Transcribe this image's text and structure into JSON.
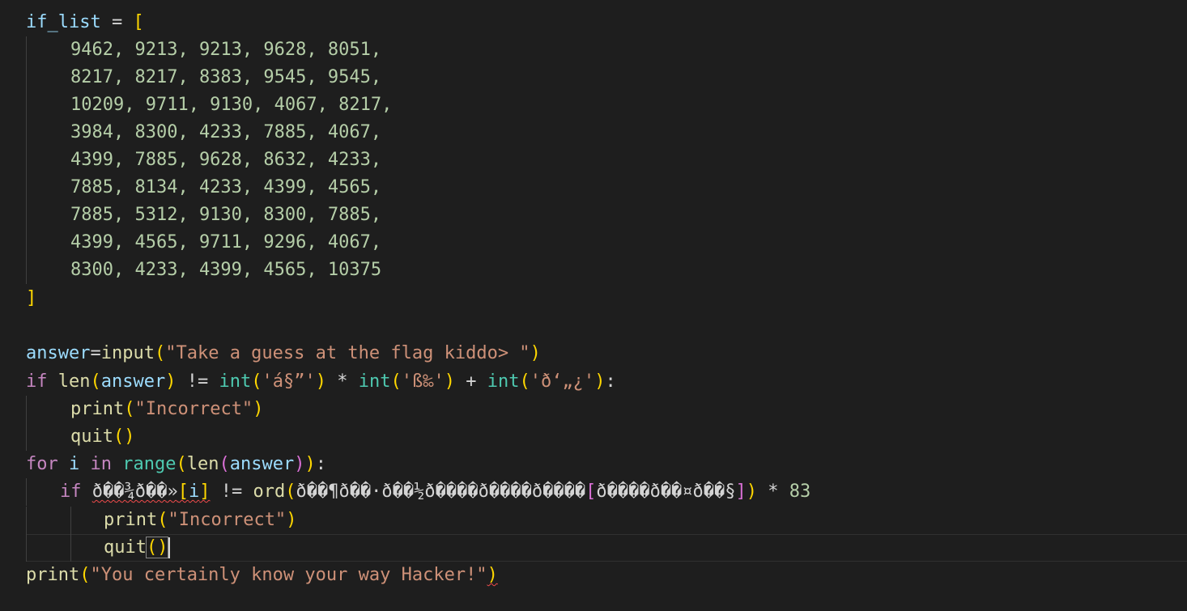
{
  "code": {
    "list_var": "if_list",
    "list_open": "[",
    "list_rows": [
      "9462, 9213, 9213, 9628, 8051,",
      "8217, 8217, 8383, 9545, 9545,",
      "10209, 9711, 9130, 4067, 8217,",
      "3984, 8300, 4233, 7885, 4067,",
      "4399, 7885, 9628, 8632, 4233,",
      "7885, 8134, 4233, 4399, 4565,",
      "7885, 5312, 9130, 8300, 7885,",
      "4399, 4565, 9711, 9296, 4067,",
      "8300, 4233, 4399, 4565, 10375"
    ],
    "list_close": "]",
    "answer_var": "answer",
    "input_fn": "input",
    "input_prompt": "\"Take a guess at the flag kiddo> \"",
    "kw_if": "if",
    "kw_for": "for",
    "kw_in": "in",
    "len_fn": "len",
    "int_fn": "int",
    "range_fn": "range",
    "print_fn": "print",
    "quit_fn": "quit",
    "ord_fn": "ord",
    "op_neq": "!=",
    "op_mul": "*",
    "op_plus": "+",
    "str_a": "'á§”'",
    "str_b": "'ß‰'",
    "str_c": "'ð‘„¿'",
    "incorrect_str": "\"Incorrect\"",
    "loop_var": "i",
    "garbled_1": "ð��¾ð��»",
    "garbled_2": "ð��¶ð��·ð��½ð����ð����ð����",
    "garbled_3": "ð����ð��¤ð��§",
    "mult_val": "83",
    "final_str": "\"You certainly know your way Hacker!\""
  }
}
